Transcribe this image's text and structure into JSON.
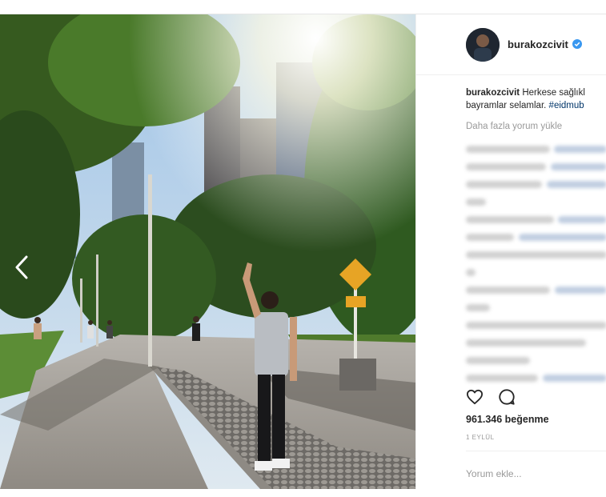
{
  "post": {
    "username": "burakozcivit",
    "caption_user": "burakozcivit",
    "caption_text_1": "Herkese sağlıkl",
    "caption_text_2": "bayramlar selamlar.",
    "caption_hashtag": "#eidmub",
    "load_more": "Daha fazla yorum yükle",
    "likes": "961.346 beğenme",
    "date": "1 EYLÜL",
    "add_comment_placeholder": "Yorum ekle..."
  },
  "icons": {
    "prev": "chevron-left-icon",
    "verified": "verified-badge-icon",
    "like": "heart-icon",
    "comment": "comment-icon"
  },
  "colors": {
    "verified": "#3897f0",
    "text": "#262626",
    "muted": "#999999",
    "hashtag": "#003569"
  }
}
